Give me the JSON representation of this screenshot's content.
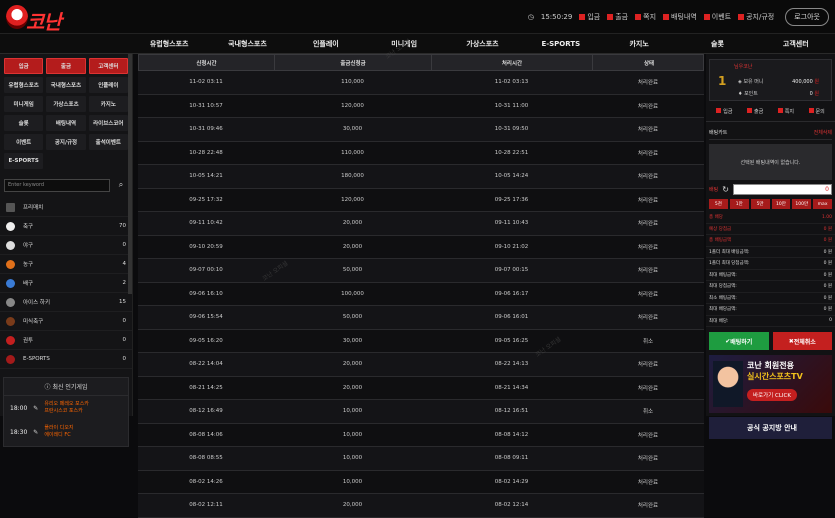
{
  "brand": {
    "logo_text": "코난"
  },
  "top": {
    "time": "15:50:29",
    "links": [
      "입금",
      "출금",
      "쪽지",
      "배팅내역",
      "이벤트",
      "공지/규정"
    ],
    "logout": "로그아웃"
  },
  "nav": [
    "유럽형스포츠",
    "국내형스포츠",
    "인플레이",
    "미니게임",
    "가상스포츠",
    "E-SPORTS",
    "카지노",
    "슬롯",
    "고객센터"
  ],
  "left": {
    "buttons": [
      "입금",
      "출금",
      "고객센터",
      "유럽형스포츠",
      "국내형스포츠",
      "인플레이",
      "미니게임",
      "가상스포츠",
      "카지노",
      "슬롯",
      "배팅내역",
      "라이브스코어",
      "이벤트",
      "공지/규정",
      "출석이벤트",
      "E-SPORTS"
    ],
    "search_placeholder": "Enter keyword",
    "sports_header": "프리매치",
    "sports": [
      {
        "name": "축구",
        "count": "70",
        "color": "#eeeeee"
      },
      {
        "name": "야구",
        "count": "0",
        "color": "#dddddd"
      },
      {
        "name": "농구",
        "count": "4",
        "color": "#e0701a"
      },
      {
        "name": "배구",
        "count": "2",
        "color": "#3a7bd5"
      },
      {
        "name": "아이스 하키",
        "count": "15",
        "color": "#888888"
      },
      {
        "name": "미식축구",
        "count": "0",
        "color": "#7a3b1a"
      },
      {
        "name": "권투",
        "count": "0",
        "color": "#c41f1f"
      },
      {
        "name": "E-SPORTS",
        "count": "0",
        "color": "#a31a1a"
      }
    ],
    "popular_title": "최신 인기게임",
    "popular": [
      {
        "time": "18:00",
        "home": "유리오 페레오 포스카",
        "away": "프란시스코 포스카"
      },
      {
        "time": "18:30",
        "home": "플라이 디오지",
        "away": "에이레디 FC"
      }
    ]
  },
  "table": {
    "headers": [
      "신청시간",
      "출금신청금",
      "처리시간",
      "상태"
    ],
    "rows": [
      [
        "11-02 03:11",
        "110,000",
        "11-02 03:13",
        "처리완료"
      ],
      [
        "10-31 10:57",
        "120,000",
        "10-31 11:00",
        "처리완료"
      ],
      [
        "10-31 09:46",
        "30,000",
        "10-31 09:50",
        "처리완료"
      ],
      [
        "10-28 22:48",
        "110,000",
        "10-28 22:51",
        "처리완료"
      ],
      [
        "10-05 14:21",
        "180,000",
        "10-05 14:24",
        "처리완료"
      ],
      [
        "09-25 17:32",
        "120,000",
        "09-25 17:36",
        "처리완료"
      ],
      [
        "09-11 10:42",
        "20,000",
        "09-11 10:43",
        "처리완료"
      ],
      [
        "09-10 20:59",
        "20,000",
        "09-10 21:02",
        "처리완료"
      ],
      [
        "09-07 00:10",
        "50,000",
        "09-07 00:15",
        "처리완료"
      ],
      [
        "09-06 16:10",
        "100,000",
        "09-06 16:17",
        "처리완료"
      ],
      [
        "09-06 15:54",
        "50,000",
        "09-06 16:01",
        "처리완료"
      ],
      [
        "09-05 16:20",
        "30,000",
        "09-05 16:25",
        "취소"
      ],
      [
        "08-22 14:04",
        "20,000",
        "08-22 14:13",
        "처리완료"
      ],
      [
        "08-21 14:25",
        "20,000",
        "08-21 14:34",
        "처리완료"
      ],
      [
        "08-12 16:49",
        "10,000",
        "08-12 16:51",
        "취소"
      ],
      [
        "08-08 14:06",
        "10,000",
        "08-08 14:12",
        "처리완료"
      ],
      [
        "08-08 08:55",
        "10,000",
        "08-08 09:11",
        "처리완료"
      ],
      [
        "08-02 14:26",
        "10,000",
        "08-02 14:29",
        "처리완료"
      ],
      [
        "08-02 12:11",
        "20,000",
        "08-02 12:14",
        "처리완료"
      ]
    ]
  },
  "right": {
    "level": "1",
    "name_label": "님우코난",
    "money_label": "보유 머니",
    "money": "400,000",
    "money_unit": "원",
    "point_label": "포인트",
    "point": "0",
    "point_unit": "원",
    "buttons": [
      "입금",
      "출금",
      "쪽지",
      "문의"
    ],
    "slip_title": "배팅카트",
    "slip_delete": "전체삭제",
    "slip_empty": "선택된 배팅내역이 없습니다.",
    "amount_label": "배팅",
    "amount": "0",
    "chips": [
      "5천",
      "1만",
      "5만",
      "10만",
      "100만",
      "max"
    ],
    "rows": [
      {
        "k": "총 배당",
        "v": "1.00",
        "red": true
      },
      {
        "k": "예상 당첨금",
        "v": "0 원",
        "red": true
      },
      {
        "k": "총 배팅금액",
        "v": "0 원",
        "red": true
      },
      {
        "k": "1폴더 최대 배팅금액:",
        "v": "0 원",
        "red": false
      },
      {
        "k": "1폴더 최대 당첨금액:",
        "v": "0 원",
        "red": false
      },
      {
        "k": "최대 배팅금액:",
        "v": "0 원",
        "red": false
      },
      {
        "k": "최대 당첨금액:",
        "v": "0 원",
        "red": false
      },
      {
        "k": "최소 배팅금액:",
        "v": "0 원",
        "red": false
      },
      {
        "k": "최대 배당금액:",
        "v": "0 원",
        "red": false
      },
      {
        "k": "최대 배당:",
        "v": "0",
        "red": false
      }
    ],
    "bet_btn": "배팅하기",
    "clear_btn": "전체취소",
    "banner_line1": "코난 회원전용",
    "banner_line2": "실시간스포츠TV",
    "banner_btn": "바로가기 CLICK",
    "banner2": "공식 공지방 안내"
  }
}
